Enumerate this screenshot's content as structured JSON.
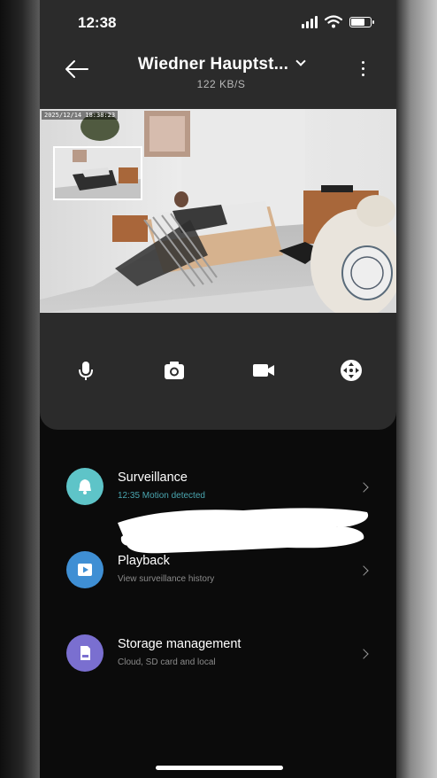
{
  "status_bar": {
    "time": "12:38"
  },
  "header": {
    "title": "Wiedner Hauptst...",
    "subtitle": "122 KB/S"
  },
  "video": {
    "timestamp": "2025/12/14 18:38:23"
  },
  "controls": [
    {
      "name": "microphone"
    },
    {
      "name": "screenshot"
    },
    {
      "name": "record"
    },
    {
      "name": "ptz"
    }
  ],
  "list": {
    "items": [
      {
        "title": "Surveillance",
        "subtitle": "12:35 Motion detected",
        "icon": "bell-icon",
        "color": "#5ec4c8"
      },
      {
        "title": "Playback",
        "subtitle": "View surveillance history",
        "icon": "play-icon",
        "color": "#3f8fd4"
      },
      {
        "title": "Storage management",
        "subtitle": "Cloud, SD card and local",
        "icon": "storage-icon",
        "color": "#7a6fd0"
      }
    ]
  },
  "colors": {
    "panel": "#2b2b2b",
    "background": "#0b0b0b",
    "accent": "#4aa6b0"
  }
}
